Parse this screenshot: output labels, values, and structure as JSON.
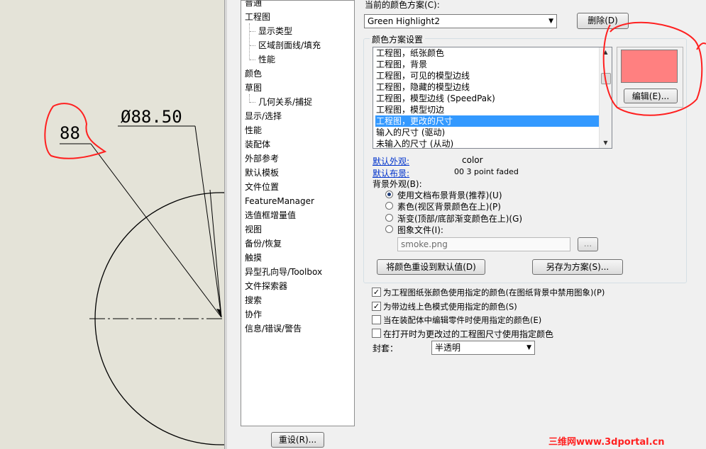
{
  "tree": {
    "items": [
      {
        "label": "普通",
        "level": 0
      },
      {
        "label": "工程图",
        "level": 0
      },
      {
        "label": "显示类型",
        "level": 1
      },
      {
        "label": "区域剖面线/填充",
        "level": 1
      },
      {
        "label": "性能",
        "level": 1
      },
      {
        "label": "颜色",
        "level": 0
      },
      {
        "label": "草图",
        "level": 0
      },
      {
        "label": "几何关系/捕捉",
        "level": 1
      },
      {
        "label": "显示/选择",
        "level": 0
      },
      {
        "label": "性能",
        "level": 0
      },
      {
        "label": "装配体",
        "level": 0
      },
      {
        "label": "外部参考",
        "level": 0
      },
      {
        "label": "默认模板",
        "level": 0
      },
      {
        "label": "文件位置",
        "level": 0
      },
      {
        "label": "FeatureManager",
        "level": 0
      },
      {
        "label": "选值框增量值",
        "level": 0
      },
      {
        "label": "视图",
        "level": 0
      },
      {
        "label": "备份/恢复",
        "level": 0
      },
      {
        "label": "触摸",
        "level": 0
      },
      {
        "label": "异型孔向导/Toolbox",
        "level": 0
      },
      {
        "label": "文件探索器",
        "level": 0
      },
      {
        "label": "搜索",
        "level": 0
      },
      {
        "label": "协作",
        "level": 0
      },
      {
        "label": "信息/错误/警告",
        "level": 0
      }
    ],
    "reset_label": "重设(R)..."
  },
  "scheme": {
    "label": "当前的颜色方案(C):",
    "value": "Green Highlight2",
    "delete_label": "删除(D)"
  },
  "settings": {
    "group_title": "颜色方案设置",
    "items": [
      "工程图，纸张颜色",
      "工程图，背景",
      "工程图，可见的模型边线",
      "工程图，隐藏的模型边线",
      "工程图，模型边线 (SpeedPak)",
      "工程图，模型切边",
      "工程图，更改的尺寸",
      "输入的尺寸 (驱动)",
      "未输入的尺寸 (从动)"
    ],
    "selected_index": 6,
    "swatch_color": "#ff8080",
    "edit_label": "编辑(E)...",
    "default_appearance_link": "默认外观:",
    "default_appearance_value": "color",
    "default_scene_link": "默认布景:",
    "default_scene_value": "00 3 point faded",
    "background_label": "背景外观(B):",
    "radios": [
      {
        "label": "使用文档布景背景(推荐)(U)",
        "checked": true
      },
      {
        "label": "素色(视区背景颜色在上)(P)",
        "checked": false
      },
      {
        "label": "渐变(顶部/底部渐变颜色在上)(G)",
        "checked": false
      },
      {
        "label": "图象文件(I):",
        "checked": false
      }
    ],
    "image_file": "smoke.png",
    "browse_label": "...",
    "reset_colors_label": "将颜色重设到默认值(D)",
    "save_as_label": "另存为方案(S)..."
  },
  "checkboxes": [
    {
      "label": "为工程图纸张颜色使用指定的颜色(在图纸背景中禁用图象)(P)",
      "checked": true
    },
    {
      "label": "为带边线上色模式使用指定的颜色(S)",
      "checked": true
    },
    {
      "label": "当在装配体中编辑零件时使用指定的颜色(E)",
      "checked": false
    },
    {
      "label": "在打开时为更改过的工程图尺寸使用指定颜色",
      "checked": false
    }
  ],
  "envelope": {
    "label": "封套：",
    "value": "半透明"
  },
  "drawing": {
    "dim1": "88",
    "dim2": "Ø88.50"
  },
  "watermark": "三维网www.3dportal.cn",
  "colors": {
    "annotation_red": "#ff2020",
    "selection_blue": "#3399ff"
  }
}
